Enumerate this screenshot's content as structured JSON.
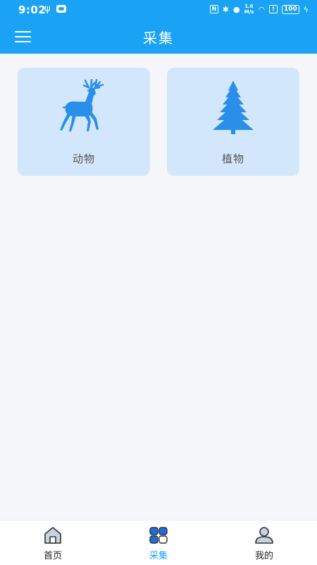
{
  "status_bar": {
    "time": "9:02",
    "speed_value": "1.6",
    "speed_unit": "M/s",
    "battery": "100"
  },
  "header": {
    "title": "采集",
    "menu_icon": "hamburger-menu-icon"
  },
  "categories": [
    {
      "label": "动物",
      "icon": "deer-icon"
    },
    {
      "label": "植物",
      "icon": "tree-icon"
    }
  ],
  "bottom_nav": {
    "active": "采集",
    "items": [
      {
        "label": "首页",
        "icon": "home-icon"
      },
      {
        "label": "采集",
        "icon": "collect-grid-icon"
      },
      {
        "label": "我的",
        "icon": "profile-icon"
      }
    ]
  },
  "colors": {
    "primary": "#1aa3f5",
    "card_bg": "#d2e7fc",
    "page_bg": "#f4f6fa",
    "icon_blue": "#2a8fe8"
  }
}
